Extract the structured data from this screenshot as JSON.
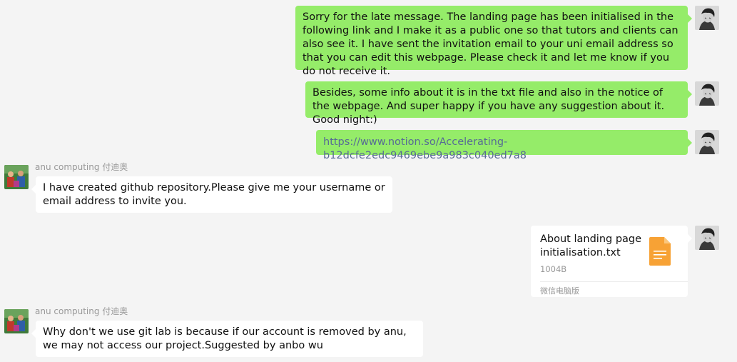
{
  "messages": {
    "m1": {
      "text": "Sorry for the late message. The landing page has been initialised in the following link and I make it as a public one so that tutors and clients can also see it. I have sent the invitation email to your uni email address so that you can edit this webpage. Please check it and let me know if you do not receive it."
    },
    "m2": {
      "text": "Besides, some info about it is in the txt file and also in the notice of the webpage. And super happy if you have any suggestion about it. Good night:)"
    },
    "m3": {
      "text": "https://www.notion.so/Accelerating-b12dcfe2edc9469ebe9a983c040ed7a8"
    },
    "m4": {
      "sender": "anu computing 付迪奥",
      "text": "I have created github repository.Please give me your username or email address to invite you."
    },
    "m5": {
      "file_name": "About landing page initialisation.txt",
      "file_size": "1004B",
      "source": "微信电脑版",
      "icon": "document-icon"
    },
    "m6": {
      "sender": "anu computing 付迪奥",
      "text": "Why don't we use git lab is because if our account is removed by anu, we may not access our project.Suggested by anbo wu"
    }
  },
  "colors": {
    "background": "#f4f4f4",
    "outgoing_bubble": "#95ec69",
    "incoming_bubble": "#ffffff",
    "link": "#576b95",
    "file_icon": "#f7a235",
    "secondary_text": "#999999"
  }
}
